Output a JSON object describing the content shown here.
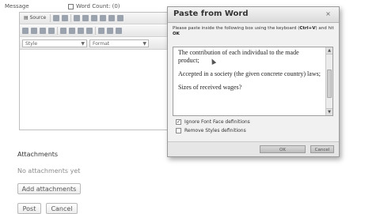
{
  "form": {
    "message_label": "Message",
    "word_count_label": "Word Count: (0)"
  },
  "toolbar": {
    "source_label": "Source",
    "style_label": "Style",
    "format_label": "Format"
  },
  "attachments": {
    "title": "Attachments",
    "empty_text": "No attachments yet",
    "add_label": "Add attachments"
  },
  "actions": {
    "post_label": "Post",
    "cancel_label": "Cancel"
  },
  "dialog": {
    "title": "Paste from Word",
    "close_symbol": "×",
    "instruction_prefix": "Please paste inside the following box using the keyboard (",
    "instruction_keys": "Ctrl+V",
    "instruction_suffix": ") and hit",
    "instruction_ok": "OK",
    "paragraphs": [
      "The contribution of each individual to the made product;",
      "Accepted in a society (the given concrete country) laws;",
      "Sizes of received wages?"
    ],
    "option_ignore_font": "Ignore Font Face definitions",
    "option_ignore_font_checked": true,
    "option_remove_styles": "Remove Styles definitions",
    "option_remove_styles_checked": false,
    "ok_label": "OK",
    "cancel_label": "Cancel"
  }
}
